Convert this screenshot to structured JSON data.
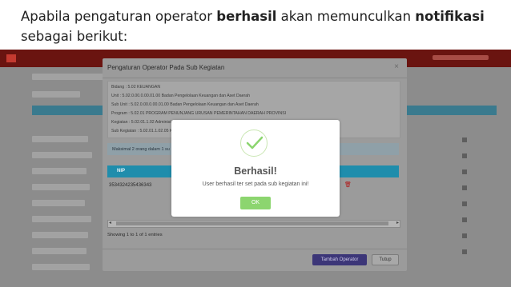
{
  "caption": {
    "part1": "Apabila pengaturan operator ",
    "bold1": "berhasil",
    "part2": " akan memunculkan ",
    "bold2": "notifikasi",
    "line2": "sebagai berikut:"
  },
  "modal": {
    "title": "Pengaturan Operator Pada Sub Kegiatan",
    "close_label": "×",
    "info_lines": [
      "Bidang : 5.02 KEUANGAN",
      "Unit : 5.02.0.00.0.00.01.00 Badan Pengelolaan Keuangan dan Aset Daerah",
      "Sub Unit : 5.02.0.00.0.00.01.00 Badan Pengelolaan Keuangan dan Aset Daerah",
      "Program : 5.02.01 PROGRAM PENUNJANG URUSAN PEMERINTAHAN DAERAH PROVINSI",
      "Kegiatan : 5.02.01.1.02 Administ",
      "Sub Kegiatan : 5.02.01.1.02.05 Ko"
    ],
    "alert_text": "Maksimal 2 orang dalam 1 su",
    "table": {
      "header_nip": "NIP",
      "rows": [
        {
          "nip": "3534324235436343"
        }
      ]
    },
    "scroll_left": "◂",
    "scroll_right": "▸",
    "showing": "Showing 1 to 1 of 1 entries",
    "btn_tambah": "Tambah Operator",
    "btn_tutup": "Tutup"
  },
  "dialog": {
    "title": "Berhasil!",
    "message": "User berhasil ter set pada sub kegiatan ini!",
    "ok_label": "OK"
  },
  "colors": {
    "success_green": "#8cd56f",
    "table_header": "#1f8dac",
    "primary_button": "#3c3678",
    "app_header": "#6a1410"
  },
  "icons": {
    "check": "check-icon",
    "trash": "trash-icon",
    "close": "close-icon"
  }
}
